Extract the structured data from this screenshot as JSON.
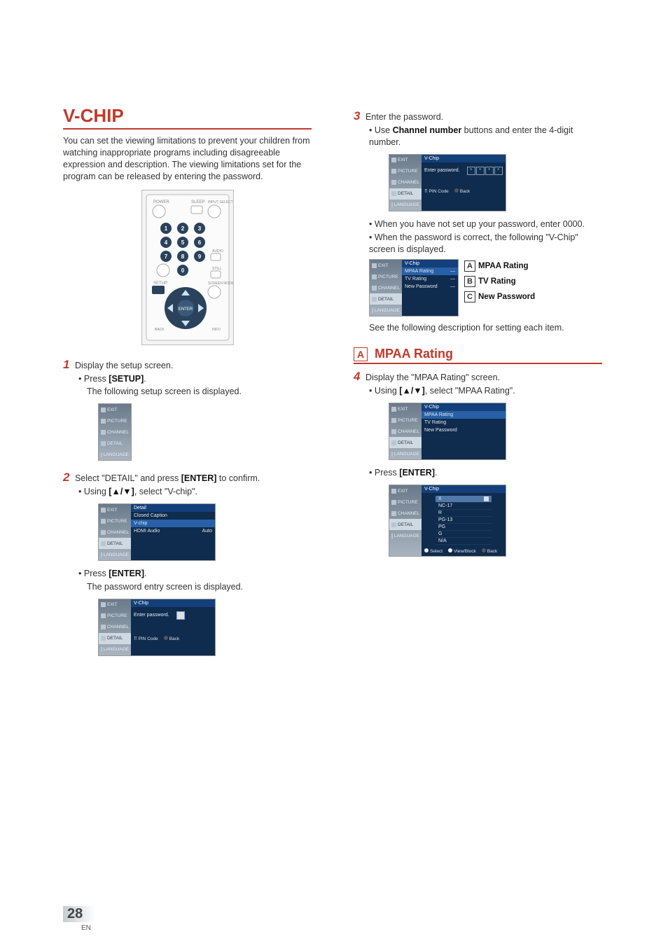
{
  "headings": {
    "vchip": "V-CHIP",
    "mpaa": "MPAA Rating"
  },
  "letters": {
    "A": "A",
    "B": "B",
    "C": "C"
  },
  "intro": "You can set the viewing limitations to prevent your children from watching inappropriate programs including disagreeable expression and description. The viewing limitations set for the program can be released by entering the password.",
  "remote": {
    "power": "POWER",
    "sleep": "SLEEP",
    "input": "INPUT SELECT",
    "audio": "AUDIO",
    "still": "STILL",
    "setup": "SETUP",
    "screen": "SCREEN MODE",
    "enter": "ENTER",
    "back": "BACK",
    "info": "INFO",
    "keys": [
      "1",
      "2",
      "3",
      "4",
      "5",
      "6",
      "7",
      "8",
      "9",
      "0"
    ]
  },
  "sidebar": {
    "items": [
      "EXIT",
      "PICTURE",
      "CHANNEL",
      "DETAIL",
      "LANGUAGE"
    ]
  },
  "steps": {
    "s1": "Display the setup screen.",
    "s1a_pre": "Press ",
    "s1a_bold": "[SETUP]",
    "s1a_post": ".",
    "s1b": "The following setup screen is displayed.",
    "s2_pre": "Select \"DETAIL\" and press ",
    "s2_bold": "[ENTER]",
    "s2_post": " to confirm.",
    "s2a_pre": "Using ",
    "s2a_bold": "[▲/▼]",
    "s2a_post": ", select \"V-chip\".",
    "s2b_pre": "Press ",
    "s2b_bold": "[ENTER]",
    "s2b_post": ".",
    "s2c": "The password entry screen is displayed.",
    "s3": "Enter the password.",
    "s3a_pre": "Use ",
    "s3a_bold": "Channel number",
    "s3a_post": " buttons and enter the 4-digit number.",
    "s3b": "When you have not set up your password, enter 0000.",
    "s3c": "When the password is correct, the following \"V-Chip\" screen is displayed.",
    "s3d": "See the following description for setting each item.",
    "s4": "Display the \"MPAA Rating\" screen.",
    "s4a_pre": "Using ",
    "s4a_bold": "[▲/▼]",
    "s4a_post": ", select \"MPAA Rating\".",
    "s4b_pre": "Press ",
    "s4b_bold": "[ENTER]",
    "s4b_post": "."
  },
  "callouts": {
    "A": "MPAA Rating",
    "B": "TV Rating",
    "C": "New Password"
  },
  "osd": {
    "detailTitle": "Detail",
    "vchipTitle": "V-Chip",
    "detail_items": [
      {
        "label": "Closed Caption",
        "val": ""
      },
      {
        "label": "V-chip",
        "val": ""
      },
      {
        "label": "HDMI Audio",
        "val": "Auto"
      }
    ],
    "enterPassword": "Enter password.",
    "pinCode": "PIN Code",
    "back": "Back",
    "vchip_items": [
      "MPAA Rating",
      "TV Rating",
      "New Password"
    ],
    "ratings": [
      "X",
      "NC-17",
      "R",
      "PG-13",
      "PG",
      "G",
      "N/A"
    ],
    "select": "Select",
    "viewBlock": "View/Block"
  },
  "pageNumber": "28",
  "pageNumberSub": "EN"
}
